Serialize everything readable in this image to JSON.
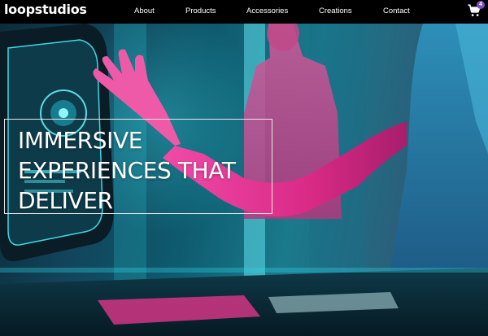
{
  "brand": {
    "logo_text": "loopstudios"
  },
  "nav": {
    "items": [
      {
        "label": "About"
      },
      {
        "label": "Products"
      },
      {
        "label": "Accessories"
      },
      {
        "label": "Creations"
      },
      {
        "label": "Contact"
      }
    ]
  },
  "cart": {
    "icon": "cart-icon",
    "count": "4",
    "badge_color": "#7d4cc8"
  },
  "hero": {
    "headline_lines": [
      "IMMERSIVE",
      "EXPERIENCES THAT",
      "DELIVER"
    ],
    "image_description_colors": {
      "magenta": "#e0338c",
      "cyan": "#2bd4e0"
    }
  }
}
